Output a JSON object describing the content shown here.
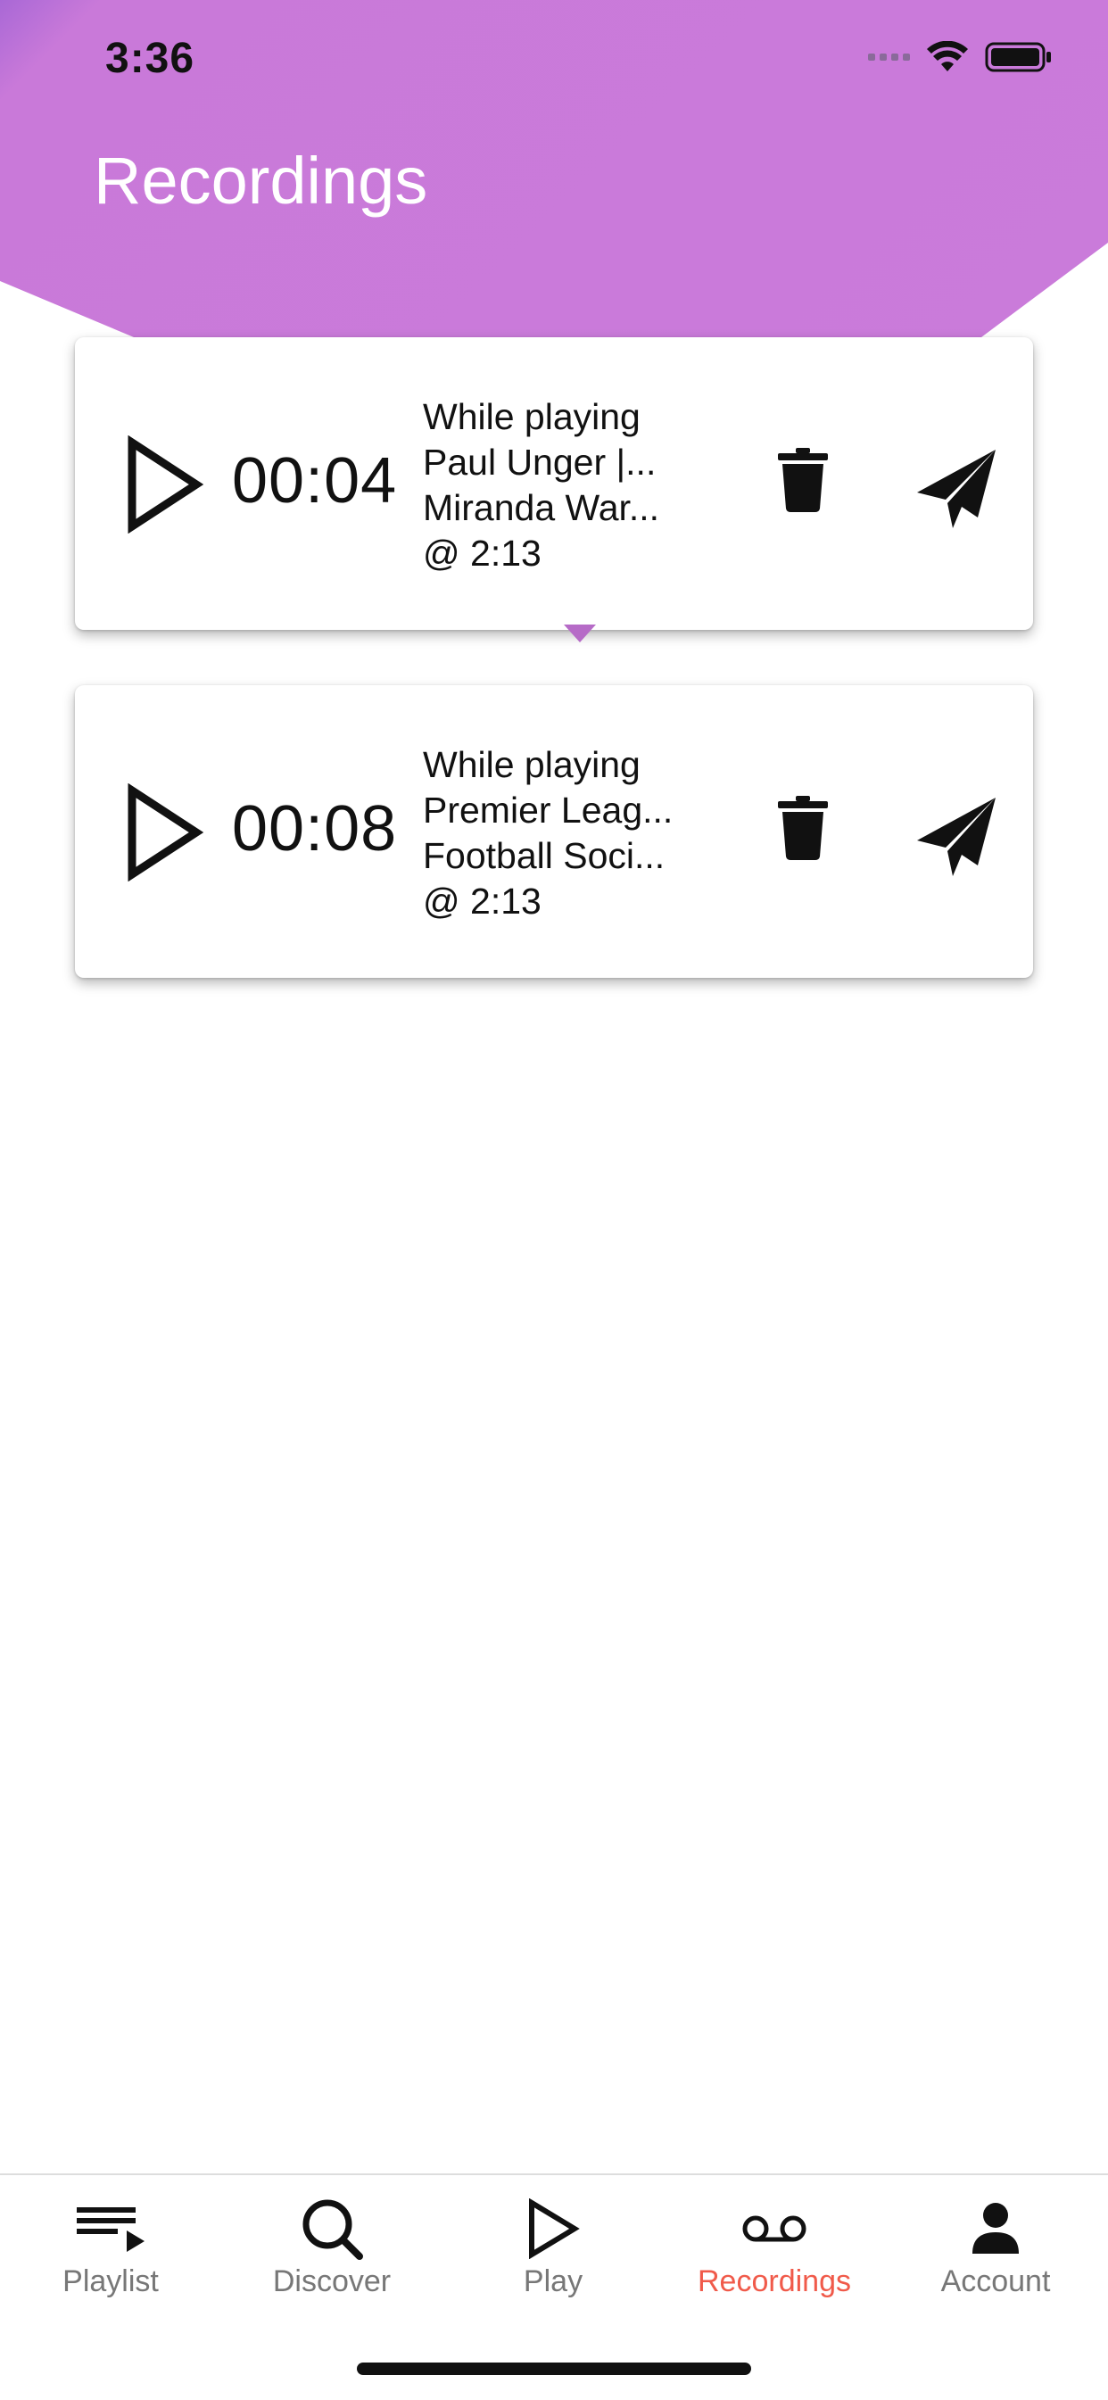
{
  "status_bar": {
    "time": "3:36"
  },
  "header": {
    "title": "Recordings"
  },
  "recordings": [
    {
      "duration": "00:04",
      "lines": [
        "While playing",
        "Paul Unger |...",
        "Miranda War...",
        "@ 2:13"
      ]
    },
    {
      "duration": "00:08",
      "lines": [
        "While playing",
        "Premier Leag...",
        "Football Soci...",
        "@ 2:13"
      ]
    }
  ],
  "tabbar": {
    "active_color": "#f05a4a",
    "tabs": [
      {
        "label": "Playlist",
        "icon": "playlist-icon"
      },
      {
        "label": "Discover",
        "icon": "search-icon"
      },
      {
        "label": "Play",
        "icon": "play-icon"
      },
      {
        "label": "Recordings",
        "icon": "voicemail-icon",
        "active": true
      },
      {
        "label": "Account",
        "icon": "person-icon"
      }
    ]
  },
  "theme": {
    "header_color": "#ca7bda"
  }
}
